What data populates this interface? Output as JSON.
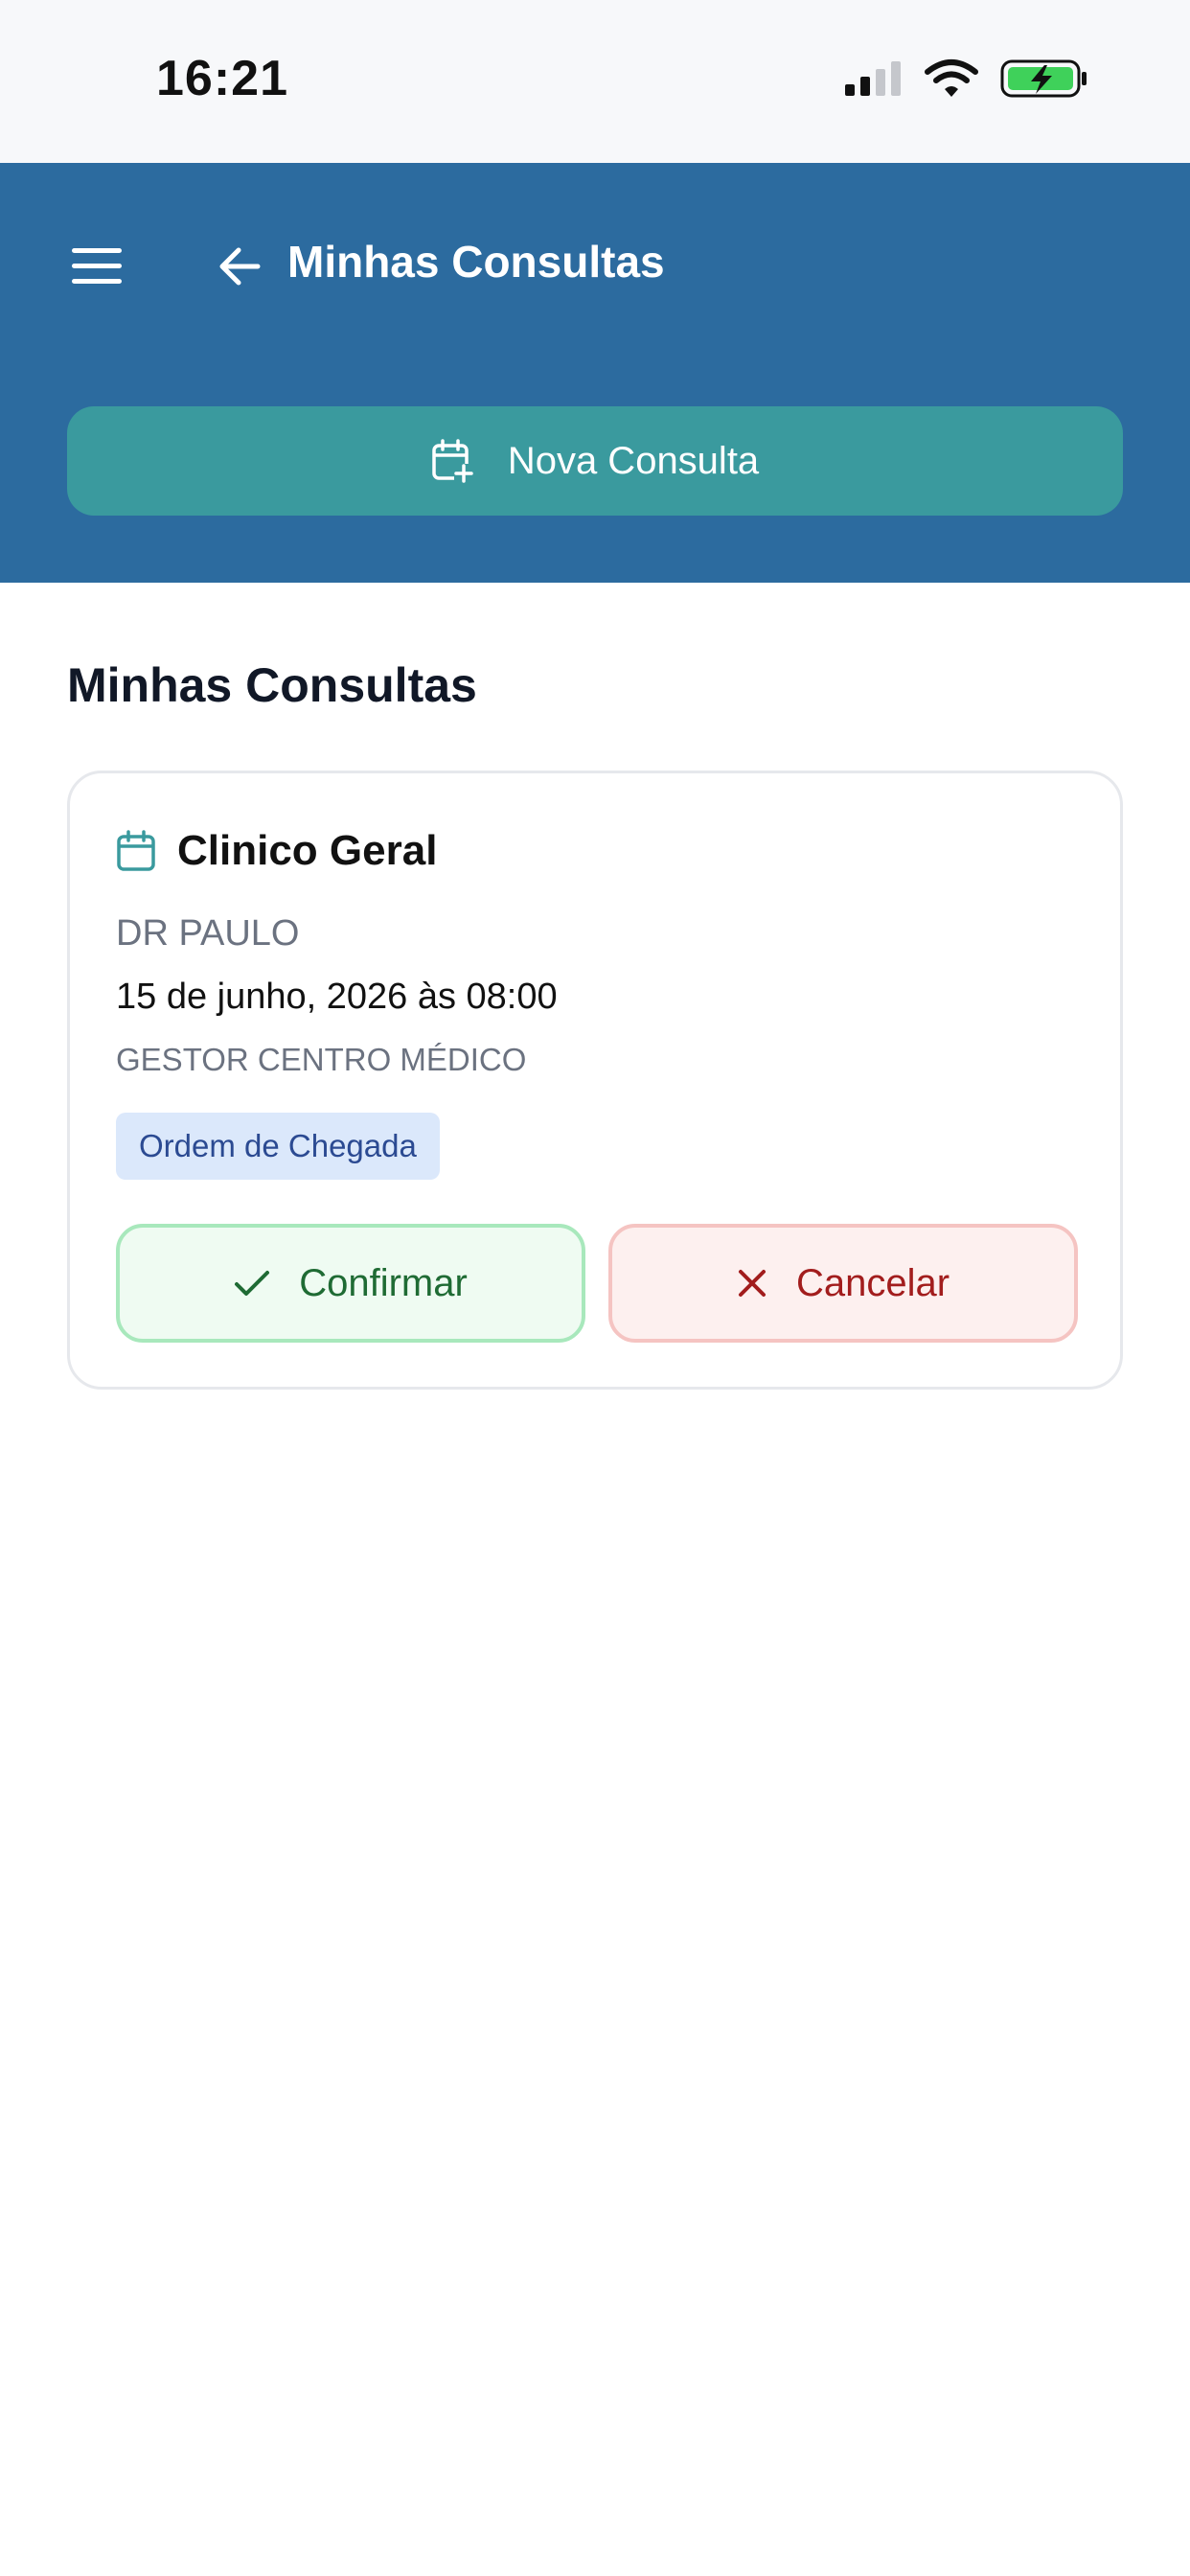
{
  "status_bar": {
    "time": "16:21",
    "icons": [
      "signal-icon",
      "wifi-icon",
      "battery-charging-icon"
    ]
  },
  "header": {
    "title": "Minhas Consultas",
    "menu_icon": "menu-icon",
    "back_icon": "arrow-left-icon",
    "new_button_label": "Nova Consulta",
    "new_button_icon": "calendar-plus-icon"
  },
  "main": {
    "section_title": "Minhas Consultas",
    "appointments": [
      {
        "icon": "calendar-icon",
        "specialty": "Clinico Geral",
        "doctor": "DR PAULO",
        "datetime": "15 de junho, 2026 às 08:00",
        "place": "GESTOR CENTRO MÉDICO",
        "tag": "Ordem de Chegada",
        "confirm_label": "Confirmar",
        "cancel_label": "Cancelar"
      }
    ]
  },
  "colors": {
    "header_bg": "#2c6b9f",
    "new_button_bg": "#3a9a9e",
    "confirm_text": "#1f6b34",
    "cancel_text": "#a21d1d",
    "tag_bg": "#dbe8fb"
  }
}
